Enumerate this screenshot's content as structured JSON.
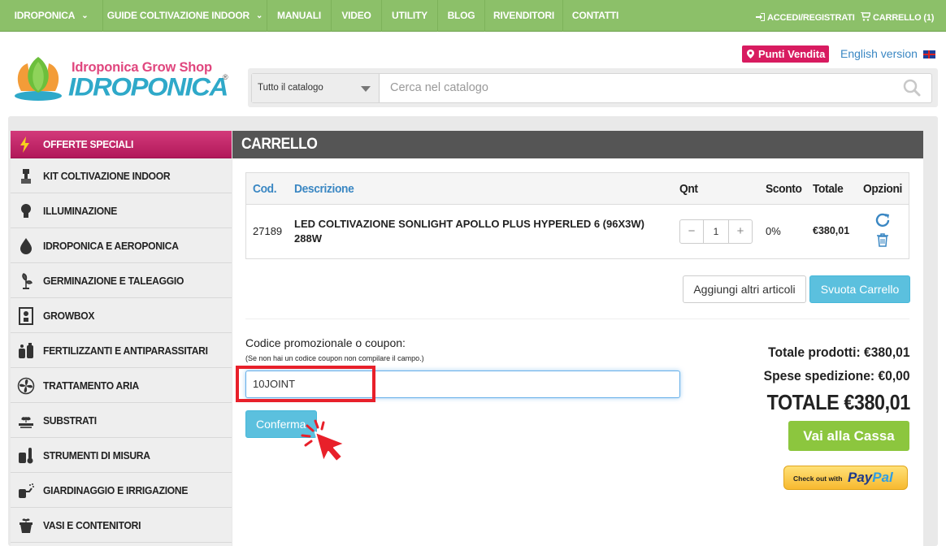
{
  "topnav": {
    "items": [
      "IDROPONICA",
      "GUIDE COLTIVAZIONE INDOOR",
      "MANUALI",
      "VIDEO",
      "UTILITY",
      "BLOG",
      "RIVENDITORI",
      "CONTATTI"
    ],
    "login": "ACCEDI/REGISTRATI",
    "cart": "CARRELLO (1)"
  },
  "header": {
    "logo_tagline": "Idroponica Grow Shop",
    "logo_name": "IDROPONICA",
    "logo_reg": "®",
    "punti_vendita": "Punti Vendita",
    "english": "English version"
  },
  "search": {
    "category": "Tutto il catalogo",
    "placeholder": "Cerca nel catalogo"
  },
  "sidebar": {
    "items": [
      {
        "label": "OFFERTE SPECIALI",
        "icon": "lightning-icon"
      },
      {
        "label": "KIT COLTIVAZIONE INDOOR",
        "icon": "kit-icon"
      },
      {
        "label": "ILLUMINAZIONE",
        "icon": "bulb-icon"
      },
      {
        "label": "IDROPONICA E AEROPONICA",
        "icon": "drop-icon"
      },
      {
        "label": "GERMINAZIONE E TALEAGGIO",
        "icon": "sprout-icon"
      },
      {
        "label": "GROWBOX",
        "icon": "growbox-icon"
      },
      {
        "label": "FERTILIZZANTI E ANTIPARASSITARI",
        "icon": "bottles-icon"
      },
      {
        "label": "TRATTAMENTO ARIA",
        "icon": "fan-icon"
      },
      {
        "label": "SUBSTRATI",
        "icon": "soil-icon"
      },
      {
        "label": "STRUMENTI DI MISURA",
        "icon": "thermometer-icon"
      },
      {
        "label": "GIARDINAGGIO E IRRIGAZIONE",
        "icon": "sprinkler-icon"
      },
      {
        "label": "VASI E CONTENITORI",
        "icon": "pot-icon"
      }
    ]
  },
  "cart": {
    "title": "CARRELLO",
    "headers": {
      "code": "Cod.",
      "desc": "Descrizione",
      "qty": "Qnt",
      "discount": "Sconto",
      "total": "Totale",
      "options": "Opzioni"
    },
    "row": {
      "code": "27189",
      "desc_line1": "LED COLTIVAZIONE SONLIGHT APOLLO PLUS HYPERLED 6 (96X3W)",
      "desc_line2": "288W",
      "qty": "1",
      "discount": "0%",
      "total": "€380,01"
    },
    "add_more": "Aggiungi altri articoli",
    "empty_cart": "Svuota Carrello",
    "coupon_label": "Codice promozionale o coupon:",
    "coupon_note": "(Se non hai un codice coupon non compilare il campo.)",
    "coupon_value": "10JOINT",
    "confirm": "Conferma",
    "total_products": "Totale prodotti: €380,01",
    "shipping": "Spese spedizione: €0,00",
    "grand_total": "TOTALE €380,01",
    "checkout": "Vai alla Cassa",
    "paypal_checkout": "Check out with",
    "paypal_pay": "Pay",
    "paypal_pal": "Pal"
  },
  "colors": {
    "nav_green": "#8cc069",
    "accent_pink": "#d81b60",
    "link_blue": "#3a87c3",
    "btn_cyan": "#5bc0de",
    "checkout_green": "#8cc63e",
    "highlight_red": "#e8202a"
  }
}
